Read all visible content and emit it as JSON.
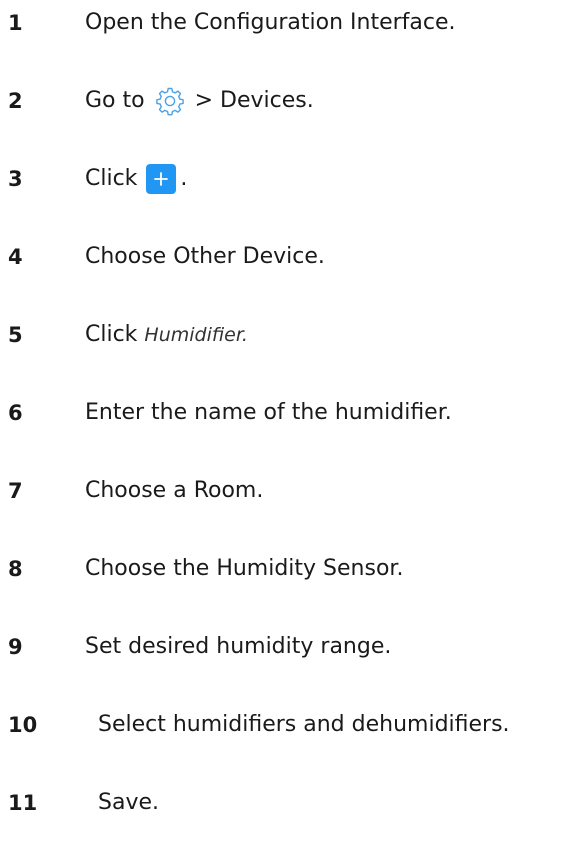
{
  "steps": [
    {
      "number": "1",
      "text": "Open the Configuration Interface."
    },
    {
      "number": "2",
      "before": "Go to",
      "icon": "gear-icon",
      "after": "> Devices."
    },
    {
      "number": "3",
      "before": "Click",
      "icon": "plus-icon",
      "after": "."
    },
    {
      "number": "4",
      "text": "Choose Other Device."
    },
    {
      "number": "5",
      "before": "Click",
      "italic": "Humidifier."
    },
    {
      "number": "6",
      "text": "Enter the name of the humidifier."
    },
    {
      "number": "7",
      "text": "Choose a Room."
    },
    {
      "number": "8",
      "text": "Choose the Humidity Sensor."
    },
    {
      "number": "9",
      "text": "Set desired humidity range."
    },
    {
      "number": "10",
      "text": "Select humidifiers and dehumidifiers."
    },
    {
      "number": "11",
      "text": "Save."
    }
  ],
  "colors": {
    "accent": "#2196f3",
    "icon_stroke": "#4aa3e8"
  }
}
